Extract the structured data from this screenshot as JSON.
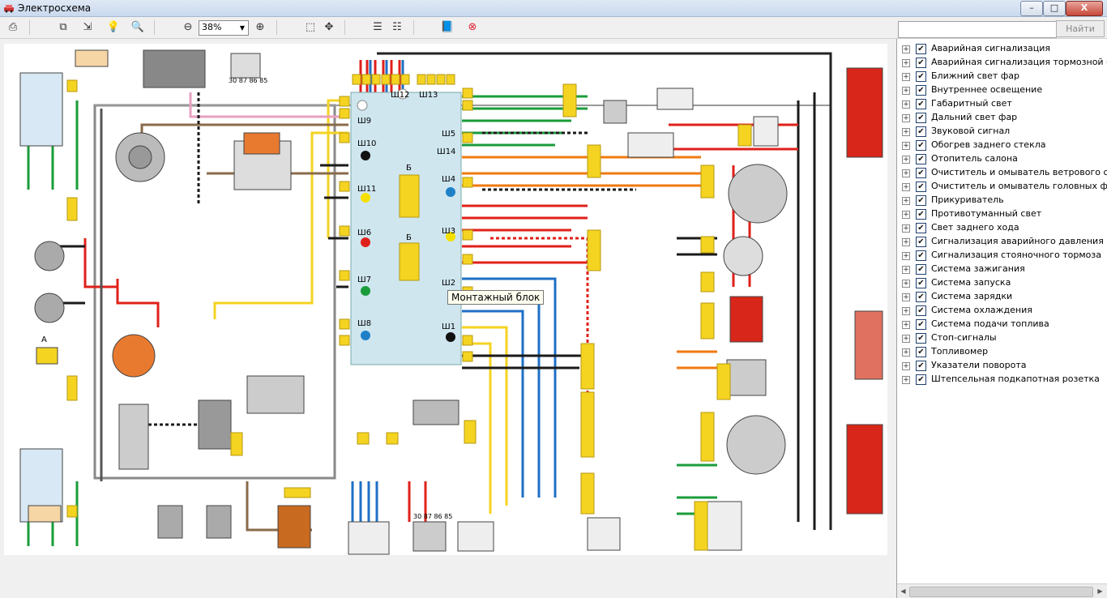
{
  "window": {
    "title": "Электросхема",
    "min": "–",
    "max": "□",
    "close": "X"
  },
  "toolbar": {
    "zoom_value": "38%",
    "icons": [
      "print-icon",
      "fit-window-icon",
      "fit-width-icon",
      "lightbulb-icon",
      "zoom-window-icon",
      "zoom-out-icon",
      "zoom-in-icon",
      "select-icon",
      "move-icon",
      "list-icon",
      "list2-icon",
      "book-icon",
      "stop-icon"
    ]
  },
  "search": {
    "placeholder": "",
    "button_label": "Найти"
  },
  "schematic": {
    "tooltip": "Монтажный блок",
    "block_labels": [
      "Ш12",
      "Ш13",
      "Ш9",
      "Ш5",
      "Ш10",
      "Ш14",
      "Ш11",
      "Ш4",
      "Ш6",
      "Ш3",
      "Ш7",
      "Ш2",
      "Ш8",
      "Ш1",
      "Б",
      "Б",
      "А"
    ],
    "relay_pins": [
      "30",
      "87",
      "86",
      "85"
    ],
    "colors": {
      "fuse_yellow": "#f5d321",
      "block_blue": "#cfe6ef",
      "wire_red": "#e0201a",
      "wire_blue": "#1f6fc4",
      "wire_green": "#1a9c3a",
      "wire_black": "#1a1a1a",
      "wire_orange": "#f07a10",
      "lamp_red": "#d8261a"
    }
  },
  "systems": [
    {
      "label": "Аварийная сигнализация",
      "checked": true
    },
    {
      "label": "Аварийная сигнализация тормозной системы",
      "checked": true
    },
    {
      "label": "Ближний свет фар",
      "checked": true
    },
    {
      "label": "Внутреннее освещение",
      "checked": true
    },
    {
      "label": "Габаритный свет",
      "checked": true
    },
    {
      "label": "Дальний свет фар",
      "checked": true
    },
    {
      "label": "Звуковой сигнал",
      "checked": true
    },
    {
      "label": "Обогрев заднего стекла",
      "checked": true
    },
    {
      "label": "Отопитель салона",
      "checked": true
    },
    {
      "label": "Очиститель и омыватель ветрового стекла",
      "checked": true
    },
    {
      "label": "Очиститель и омыватель головных фар",
      "checked": true
    },
    {
      "label": "Прикуриватель",
      "checked": true
    },
    {
      "label": "Противотуманный свет",
      "checked": true
    },
    {
      "label": "Свет заднего хода",
      "checked": true
    },
    {
      "label": "Сигнализация аварийного давления масла",
      "checked": true
    },
    {
      "label": "Сигнализация стояночного тормоза",
      "checked": true
    },
    {
      "label": "Система зажигания",
      "checked": true
    },
    {
      "label": "Система запуска",
      "checked": true
    },
    {
      "label": "Система зарядки",
      "checked": true
    },
    {
      "label": "Система охлаждения",
      "checked": true
    },
    {
      "label": "Система подачи топлива",
      "checked": true
    },
    {
      "label": "Стоп-сигналы",
      "checked": true
    },
    {
      "label": "Топливомер",
      "checked": true
    },
    {
      "label": "Указатели поворота",
      "checked": true
    },
    {
      "label": "Штепсельная подкапотная розетка",
      "checked": true
    }
  ]
}
